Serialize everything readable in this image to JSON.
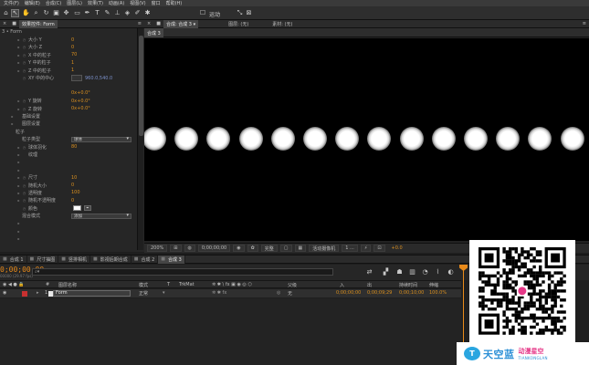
{
  "menu": [
    "文件(F)",
    "编辑(E)",
    "合成(C)",
    "图层(L)",
    "效果(T)",
    "动画(A)",
    "视图(V)",
    "窗口",
    "帮助(H)"
  ],
  "toolbar": {
    "workspace": "运动"
  },
  "effect_panel": {
    "tab_close": "×",
    "tab_label": "效果控件: Form",
    "layer_label": "3 • Form",
    "rows": [
      {
        "indent": 2,
        "tri": true,
        "stop": true,
        "label": "大小 Y",
        "value": "0"
      },
      {
        "indent": 2,
        "tri": true,
        "stop": true,
        "label": "大小 Z",
        "value": "0"
      },
      {
        "indent": 2,
        "tri": true,
        "stop": true,
        "label": "X 中的粒子",
        "value": "70"
      },
      {
        "indent": 2,
        "tri": true,
        "stop": true,
        "label": "Y 中的粒子",
        "value": "1"
      },
      {
        "indent": 2,
        "tri": true,
        "stop": true,
        "label": "Z 中的粒子",
        "value": "1"
      },
      {
        "indent": 2,
        "tri": false,
        "stop": true,
        "label": "XY 中的中心",
        "value": "960.0,540.0",
        "blue": true
      },
      {
        "indent": 2,
        "tri": false,
        "stop": false,
        "label": "",
        "value": ""
      },
      {
        "indent": 2,
        "tri": false,
        "stop": false,
        "label": "",
        "value": "0x+0.0°"
      },
      {
        "indent": 2,
        "tri": true,
        "stop": true,
        "label": "Y 旋转",
        "value": "0x+0.0°"
      },
      {
        "indent": 2,
        "tri": true,
        "stop": true,
        "label": "Z 旋转",
        "value": "0x+0.0°"
      },
      {
        "indent": 1,
        "tri": true,
        "stop": false,
        "label": "基础设置",
        "value": ""
      },
      {
        "indent": 1,
        "tri": true,
        "stop": false,
        "label": "图层设置",
        "value": ""
      },
      {
        "indent": 0,
        "tri": false,
        "stop": false,
        "label": "粒子",
        "value": ""
      },
      {
        "indent": 1,
        "tri": false,
        "stop": false,
        "label": "粒子类型",
        "dropdown": "球体"
      },
      {
        "indent": 2,
        "tri": true,
        "stop": true,
        "label": "球体羽化",
        "value": "80"
      },
      {
        "indent": 2,
        "tri": true,
        "stop": false,
        "label": "纹理",
        "value": ""
      },
      {
        "indent": 2,
        "tri": true,
        "stop": false,
        "label": "",
        "value": ""
      },
      {
        "indent": 2,
        "tri": true,
        "stop": false,
        "label": "",
        "value": ""
      },
      {
        "indent": 2,
        "tri": true,
        "stop": true,
        "label": "尺寸",
        "value": "10"
      },
      {
        "indent": 2,
        "tri": true,
        "stop": true,
        "label": "随机大小",
        "value": "0"
      },
      {
        "indent": 2,
        "tri": true,
        "stop": true,
        "label": "透明度",
        "value": "100"
      },
      {
        "indent": 2,
        "tri": true,
        "stop": true,
        "label": "随机不透明度",
        "value": "0"
      },
      {
        "indent": 2,
        "tri": false,
        "stop": true,
        "label": "颜色",
        "color": true
      },
      {
        "indent": 1,
        "tri": false,
        "stop": false,
        "label": "混合模式",
        "dropdown": "添加"
      },
      {
        "indent": 2,
        "tri": true,
        "stop": false,
        "label": "",
        "value": ""
      },
      {
        "indent": 2,
        "tri": true,
        "stop": false,
        "label": "",
        "value": ""
      },
      {
        "indent": 2,
        "tri": true,
        "stop": false,
        "label": "",
        "value": ""
      }
    ]
  },
  "comp_panel": {
    "tabs": [
      "合成: 合成 3 ▾",
      "图层: (无)",
      "素材: (无)"
    ],
    "sub_tab": "合成 3"
  },
  "viewer": {
    "orb_count": 14,
    "orb_color": "#ffffff",
    "background": "#000000"
  },
  "viewer_bar": {
    "zoom": "200%",
    "timecode": "0;00;00;00",
    "quality": "完整",
    "camera": "活动摄像机",
    "views": "1 ...",
    "exposure": "+0.0"
  },
  "timeline": {
    "tabs": [
      "合成 1",
      "尺寸抽图",
      "竖排相机",
      "影视后期合成",
      "合成 2",
      "合成 3"
    ],
    "current_time": "0;00;00;00",
    "fps": "00000 (29.97 fps)",
    "columns": [
      "图层名称",
      "模式",
      "T",
      "TrkMat",
      "父级",
      "入",
      "出",
      "持续时间",
      "伸缩"
    ],
    "layer": {
      "index": "1",
      "name": "Form",
      "mode": "正常",
      "parent": "无",
      "in": "0;00;00;00",
      "out": "0;00;09;29",
      "duration": "0;00;10;00",
      "stretch": "100.0%"
    }
  },
  "watermark": {
    "brand_logo": "T",
    "brand_name": "天空蓝",
    "brand_tag": "动漫星空",
    "brand_sub": "TIANKONGLAN",
    "qr_dark": "#000000",
    "qr_accent": "#e63888"
  },
  "colors": {
    "accent": "#e88a1a",
    "value_orange": "#d98f1f"
  }
}
